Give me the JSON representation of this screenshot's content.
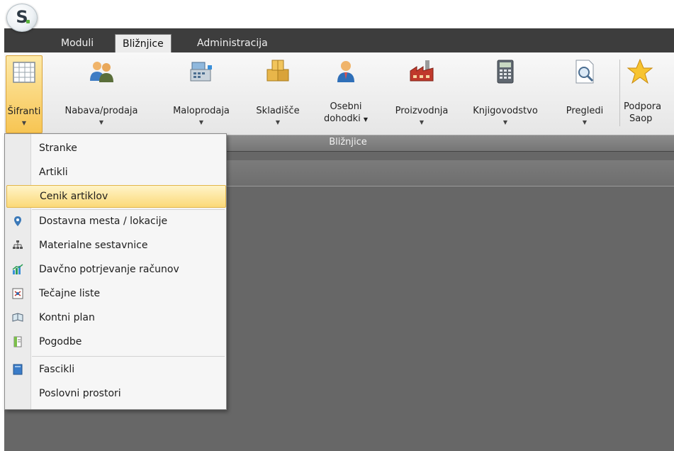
{
  "app": {
    "logo_letter": "S"
  },
  "tabs": [
    {
      "label": "Moduli",
      "active": false
    },
    {
      "label": "Bližnjice",
      "active": true
    },
    {
      "label": "Administracija",
      "active": false
    }
  ],
  "ribbon": {
    "buttons": [
      {
        "line1": "Šifranti",
        "line2": "",
        "icon": "grid-table-icon",
        "has_dropdown": true,
        "active": true
      },
      {
        "line1": "Nabava/prodaja",
        "line2": "",
        "icon": "people-icon",
        "has_dropdown": true
      },
      {
        "line1": "Maloprodaja",
        "line2": "",
        "icon": "cash-register-icon",
        "has_dropdown": true
      },
      {
        "line1": "Skladišče",
        "line2": "",
        "icon": "boxes-icon",
        "has_dropdown": true
      },
      {
        "line1": "Osebni",
        "line2": "dohodki",
        "icon": "person-icon",
        "has_dropdown": true
      },
      {
        "line1": "Proizvodnja",
        "line2": "",
        "icon": "factory-icon",
        "has_dropdown": true
      },
      {
        "line1": "Knjigovodstvo",
        "line2": "",
        "icon": "calculator-icon",
        "has_dropdown": true
      },
      {
        "line1": "Pregledi",
        "line2": "",
        "icon": "magnifier-document-icon",
        "has_dropdown": true
      },
      {
        "line1": "Podpora",
        "line2": "Saop",
        "icon": "star-icon",
        "has_dropdown": false
      }
    ],
    "group_label": "Bližnjice"
  },
  "menu": {
    "items": [
      {
        "label": "Stranke",
        "icon": ""
      },
      {
        "label": "Artikli",
        "icon": ""
      },
      {
        "label": "Cenik artiklov",
        "icon": "",
        "highlighted": true
      },
      {
        "label": "Dostavna mesta / lokacije",
        "icon": "location-pin-icon"
      },
      {
        "label": "Materialne sestavnice",
        "icon": "hierarchy-icon"
      },
      {
        "label": "Davčno potrjevanje računov",
        "icon": "bar-chart-icon"
      },
      {
        "label": "Tečajne liste",
        "icon": "exchange-rates-icon"
      },
      {
        "label": "Kontni plan",
        "icon": "book-icon"
      },
      {
        "label": "Pogodbe",
        "icon": "contract-icon"
      },
      {
        "label": "Fascikli",
        "icon": "folder-icon"
      },
      {
        "label": "Poslovni prostori",
        "icon": ""
      }
    ]
  },
  "colors": {
    "tabstrip": "#3d3d3d",
    "workspace": "#676767",
    "highlight": "#fbd978",
    "active_button": "#f7c553"
  }
}
